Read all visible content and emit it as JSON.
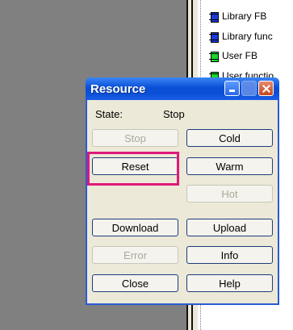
{
  "tree": {
    "items": [
      {
        "label": "Library FB",
        "color": "#1a3ad8"
      },
      {
        "label": "Library func",
        "color": "#1a3ad8"
      },
      {
        "label": "User FB",
        "color": "#1ad82a"
      },
      {
        "label": "User functio",
        "color": "#1ad82a"
      }
    ]
  },
  "dialog": {
    "title": "Resource",
    "state_label": "State:",
    "state_value": "Stop",
    "buttons": {
      "stop": "Stop",
      "cold": "Cold",
      "reset": "Reset",
      "warm": "Warm",
      "hot": "Hot",
      "download": "Download",
      "upload": "Upload",
      "error": "Error",
      "info": "Info",
      "close": "Close",
      "help": "Help"
    }
  },
  "colors": {
    "titlebar": "#0a4fd6",
    "highlight": "#e0197a",
    "dialog_bg": "#ece9d8"
  }
}
